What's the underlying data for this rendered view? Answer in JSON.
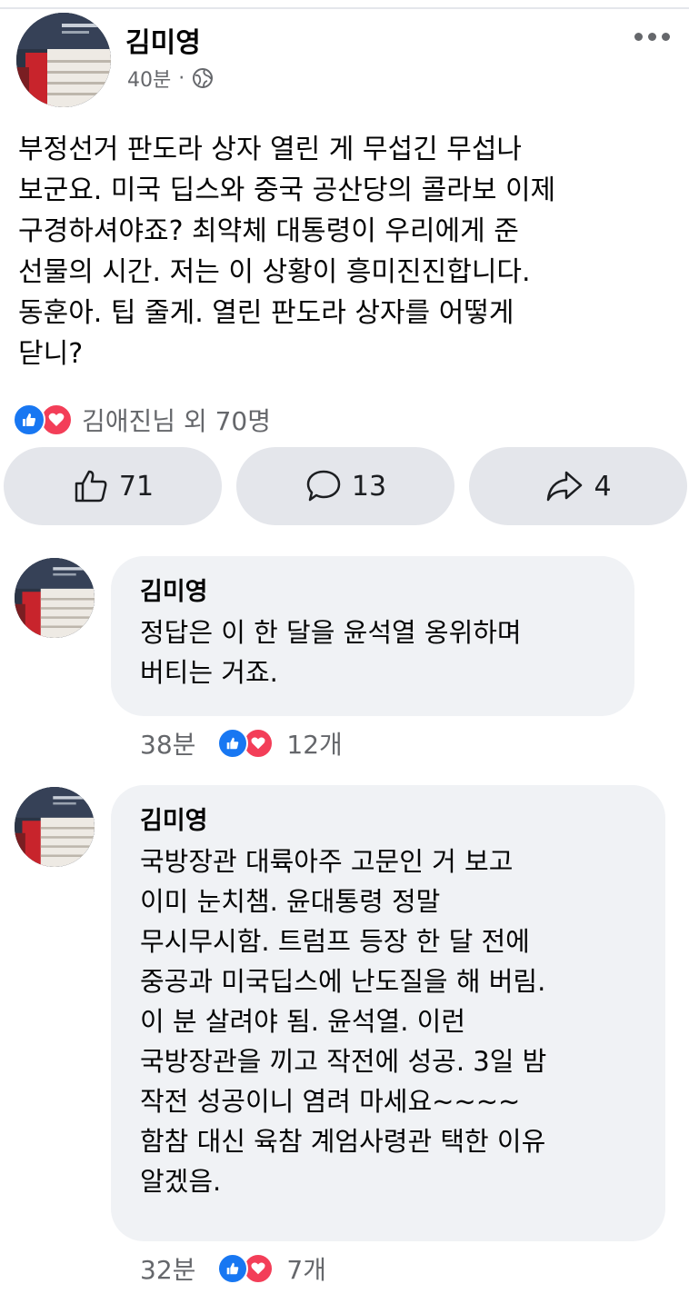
{
  "post": {
    "author": "김미영",
    "time": "40분",
    "dot": "·",
    "privacy_icon": "globe-icon",
    "text": "부정선거 판도라 상자 열린 게 무섭긴 무섭나\n보군요. 미국 딥스와 중국 공산당의 콜라보 이제\n구경하셔야죠? 최약체 대통령이 우리에게 준\n선물의 시간. 저는 이 상황이 흥미진진합니다.\n동훈아. 팁 줄게. 열린 판도라 상자를 어떻게\n닫니?",
    "reactions_text": "김애진님 외 70명"
  },
  "actions": {
    "like_count": "71",
    "comment_count": "13",
    "share_count": "4"
  },
  "comments": [
    {
      "author": "김미영",
      "text": "정답은 이 한 달을 윤석열 옹위하며\n버티는 거죠.",
      "time": "38분",
      "reaction_count": "12개"
    },
    {
      "author": "김미영",
      "text": "국방장관 대륙아주 고문인 거 보고\n이미 눈치챔. 윤대통령 정말\n무시무시함. 트럼프 등장 한 달 전에\n중공과 미국딥스에 난도질을 해 버림.\n이 분 살려야 됨. 윤석열. 이런\n국방장관을 끼고 작전에 성공. 3일 밤\n작전 성공이니 염려 마세요~~~~\n함참 대신 육참 계엄사령관 택한 이유\n알겠음.",
      "time": "32분",
      "reaction_count": "7개"
    }
  ],
  "colors": {
    "like_blue": "#1877f2",
    "love_red": "#f33e58",
    "bubble_bg": "#f0f2f5",
    "button_bg": "#e4e6eb",
    "meta_gray": "#65676b"
  }
}
